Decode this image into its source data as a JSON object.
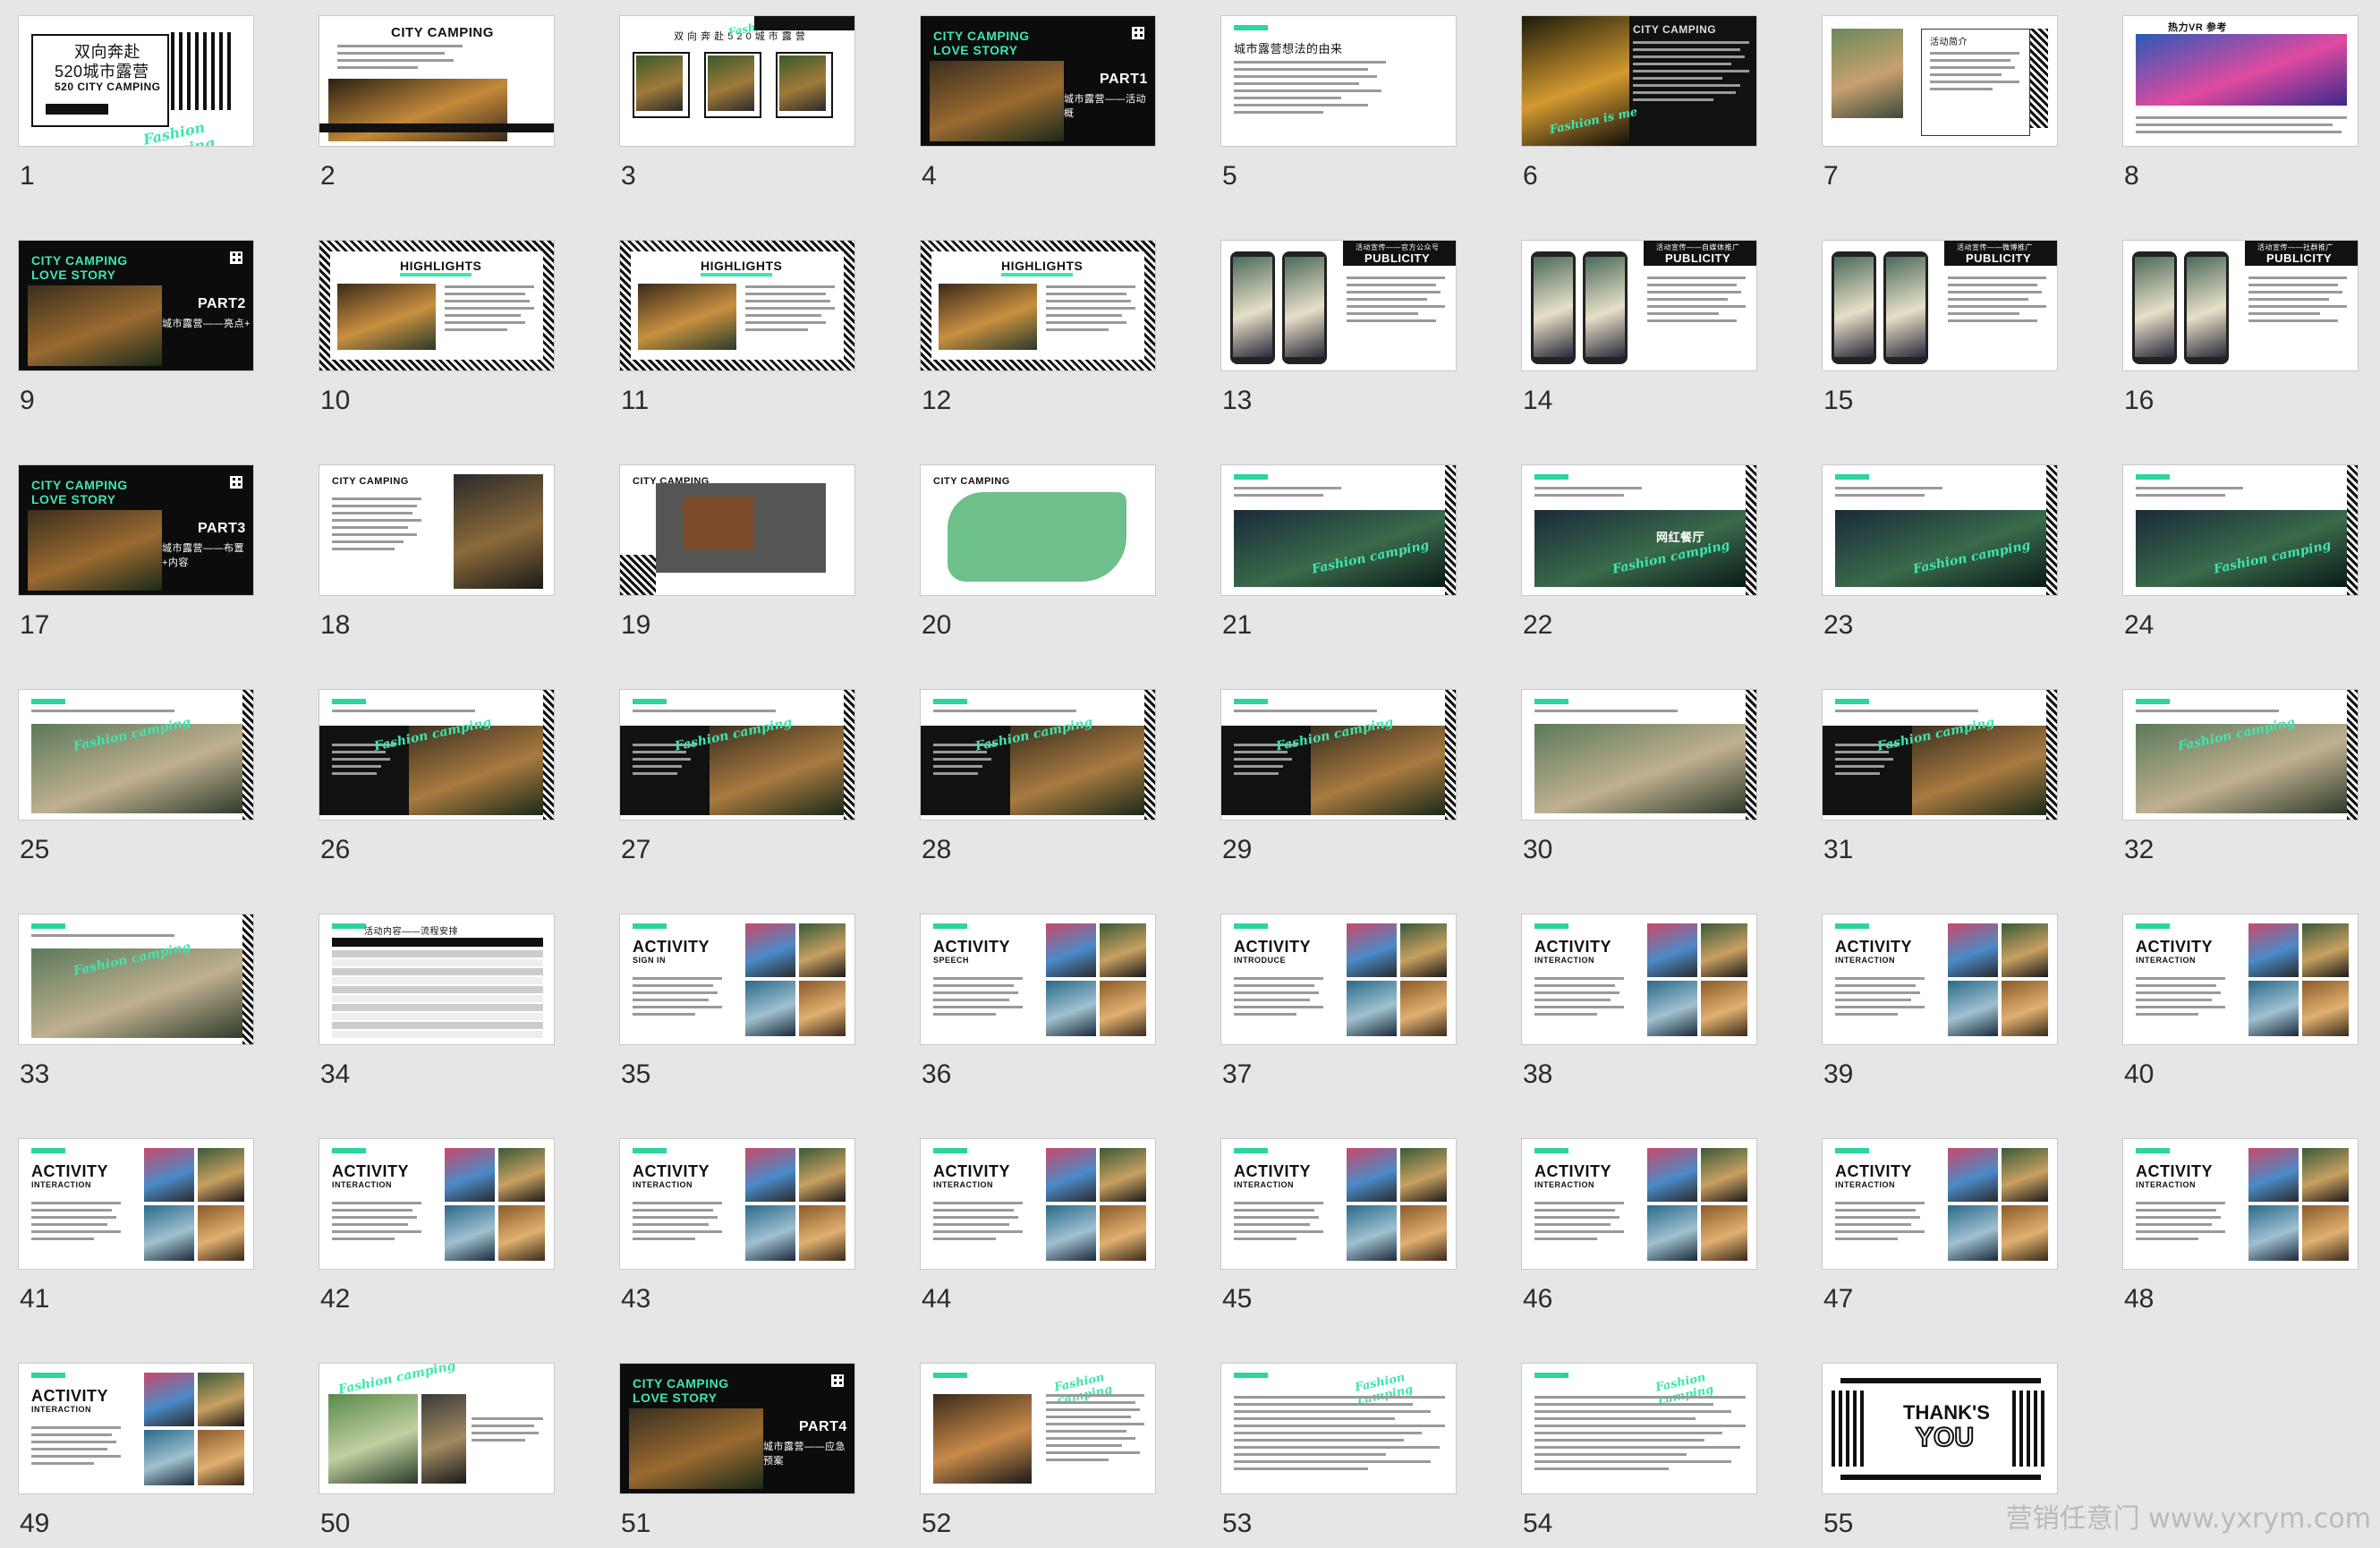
{
  "watermark": "营销任意门 www.yxrym.com",
  "colors": {
    "background": "#e6e6e6",
    "accent_green": "#3ee6b0",
    "dark": "#111111"
  },
  "slides": [
    {
      "number": "1",
      "layout": "cover",
      "texts": [
        "双向奔赴",
        "520城市露营",
        "520 CITY CAMPING",
        "Fashion camping"
      ]
    },
    {
      "number": "2",
      "layout": "white-photo-bottom",
      "texts": [
        "CITY CAMPING"
      ]
    },
    {
      "number": "3",
      "layout": "white-three-photos",
      "texts": [
        "双 向 奔 赴 5 2 0 城 市 露 营",
        "Fashion is me"
      ]
    },
    {
      "number": "4",
      "layout": "dark-part",
      "texts": [
        "CITY CAMPING",
        "LOVE STORY",
        "PART1",
        "城市露营——活动概"
      ]
    },
    {
      "number": "5",
      "layout": "white-text",
      "texts": [
        "城市露营想法的由来"
      ]
    },
    {
      "number": "6",
      "layout": "dark-photo-text",
      "texts": [
        "CITY CAMPING",
        "Fashion is me"
      ]
    },
    {
      "number": "7",
      "layout": "white-photo-card",
      "texts": [
        "活动简介"
      ]
    },
    {
      "number": "8",
      "layout": "white-banner",
      "texts": [
        "热力VR 参考"
      ]
    },
    {
      "number": "9",
      "layout": "dark-part",
      "texts": [
        "CITY CAMPING",
        "LOVE STORY",
        "PART2",
        "城市露营——亮点+"
      ]
    },
    {
      "number": "10",
      "layout": "highlights",
      "texts": [
        "HIGHLIGHTS"
      ]
    },
    {
      "number": "11",
      "layout": "highlights",
      "texts": [
        "HIGHLIGHTS"
      ]
    },
    {
      "number": "12",
      "layout": "highlights",
      "texts": [
        "HIGHLIGHTS"
      ]
    },
    {
      "number": "13",
      "layout": "publicity",
      "texts": [
        "活动宣传——官方公众号",
        "PUBLICITY"
      ]
    },
    {
      "number": "14",
      "layout": "publicity",
      "texts": [
        "活动宣传——自媒体推广",
        "PUBLICITY"
      ]
    },
    {
      "number": "15",
      "layout": "publicity",
      "texts": [
        "活动宣传——微博推广",
        "PUBLICITY"
      ]
    },
    {
      "number": "16",
      "layout": "publicity",
      "texts": [
        "活动宣传——社群推广",
        "PUBLICITY"
      ]
    },
    {
      "number": "17",
      "layout": "dark-part",
      "texts": [
        "CITY CAMPING",
        "LOVE STORY",
        "PART3",
        "城市露营——布置+内容"
      ]
    },
    {
      "number": "18",
      "layout": "white-photo-right",
      "texts": [
        "CITY CAMPING"
      ]
    },
    {
      "number": "19",
      "layout": "floorplan",
      "texts": [
        "CITY CAMPING"
      ]
    },
    {
      "number": "20",
      "layout": "map",
      "texts": [
        "CITY CAMPING"
      ]
    },
    {
      "number": "21",
      "layout": "zone",
      "texts": [
        "Fashion camping"
      ]
    },
    {
      "number": "22",
      "layout": "zone",
      "texts": [
        "Fashion camping",
        "网红餐厅"
      ]
    },
    {
      "number": "23",
      "layout": "zone",
      "texts": [
        "Fashion camping"
      ]
    },
    {
      "number": "24",
      "layout": "zone",
      "texts": [
        "Fashion camping"
      ]
    },
    {
      "number": "25",
      "layout": "area",
      "texts": [
        "Fashion camping"
      ]
    },
    {
      "number": "26",
      "layout": "area-dark",
      "texts": [
        "Fashion camping"
      ]
    },
    {
      "number": "27",
      "layout": "area-dark",
      "texts": [
        "Fashion camping"
      ]
    },
    {
      "number": "28",
      "layout": "area-dark",
      "texts": [
        "Fashion camping"
      ]
    },
    {
      "number": "29",
      "layout": "area-dark",
      "texts": [
        "Fashion camping"
      ]
    },
    {
      "number": "30",
      "layout": "area",
      "texts": []
    },
    {
      "number": "31",
      "layout": "area-dark",
      "texts": [
        "Fashion camping"
      ]
    },
    {
      "number": "32",
      "layout": "area",
      "texts": [
        "Fashion camping"
      ]
    },
    {
      "number": "33",
      "layout": "area",
      "texts": [
        "Fashion camping"
      ]
    },
    {
      "number": "34",
      "layout": "table",
      "texts": [
        "活动内容——流程安排"
      ]
    },
    {
      "number": "35",
      "layout": "activity",
      "texts": [
        "ACTIVITY",
        "SIGN IN"
      ]
    },
    {
      "number": "36",
      "layout": "activity",
      "texts": [
        "ACTIVITY",
        "SPEECH"
      ]
    },
    {
      "number": "37",
      "layout": "activity",
      "texts": [
        "ACTIVITY",
        "INTRODUCE"
      ]
    },
    {
      "number": "38",
      "layout": "activity",
      "texts": [
        "ACTIVITY",
        "INTERACTION"
      ]
    },
    {
      "number": "39",
      "layout": "activity",
      "texts": [
        "ACTIVITY",
        "INTERACTION"
      ]
    },
    {
      "number": "40",
      "layout": "activity",
      "texts": [
        "ACTIVITY",
        "INTERACTION"
      ]
    },
    {
      "number": "41",
      "layout": "activity",
      "texts": [
        "ACTIVITY",
        "INTERACTION"
      ]
    },
    {
      "number": "42",
      "layout": "activity",
      "texts": [
        "ACTIVITY",
        "INTERACTION"
      ]
    },
    {
      "number": "43",
      "layout": "activity",
      "texts": [
        "ACTIVITY",
        "INTERACTION"
      ]
    },
    {
      "number": "44",
      "layout": "activity",
      "texts": [
        "ACTIVITY",
        "INTERACTION"
      ]
    },
    {
      "number": "45",
      "layout": "activity",
      "texts": [
        "ACTIVITY",
        "INTERACTION"
      ]
    },
    {
      "number": "46",
      "layout": "activity",
      "texts": [
        "ACTIVITY",
        "INTERACTION"
      ]
    },
    {
      "number": "47",
      "layout": "activity",
      "texts": [
        "ACTIVITY",
        "INTERACTION"
      ]
    },
    {
      "number": "48",
      "layout": "activity",
      "texts": [
        "ACTIVITY",
        "INTERACTION"
      ]
    },
    {
      "number": "49",
      "layout": "activity",
      "texts": [
        "ACTIVITY",
        "INTERACTION"
      ]
    },
    {
      "number": "50",
      "layout": "collage",
      "texts": [
        "Fashion camping"
      ]
    },
    {
      "number": "51",
      "layout": "dark-part",
      "texts": [
        "CITY CAMPING",
        "LOVE STORY",
        "PART4",
        "城市露营——应急预案"
      ]
    },
    {
      "number": "52",
      "layout": "emergency",
      "texts": [
        "Fashion camping"
      ]
    },
    {
      "number": "53",
      "layout": "emergency-text",
      "texts": [
        "Fashion camping"
      ]
    },
    {
      "number": "54",
      "layout": "emergency-text",
      "texts": [
        "Fashion camping"
      ]
    },
    {
      "number": "55",
      "layout": "thanks",
      "texts": [
        "THANK'S",
        "YOU"
      ]
    }
  ]
}
